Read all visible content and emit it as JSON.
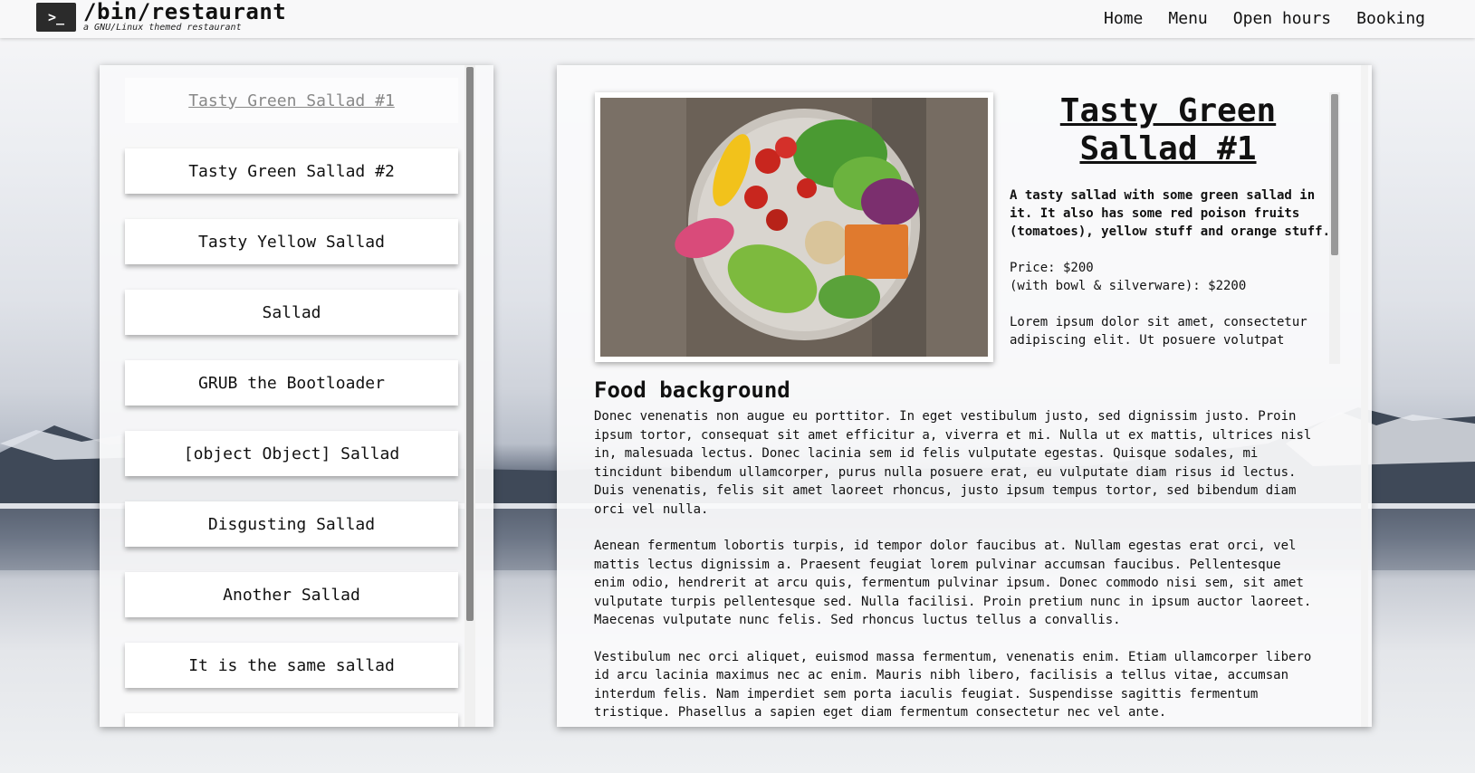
{
  "header": {
    "logo_glyph": ">_",
    "title": "/bin/restaurant",
    "tagline": "a GNU/Linux themed restaurant",
    "nav": [
      "Home",
      "Menu",
      "Open hours",
      "Booking"
    ]
  },
  "menu": {
    "items": [
      "Tasty Green Sallad #1",
      "Tasty Green Sallad #2",
      "Tasty Yellow Sallad",
      "Sallad",
      "GRUB the Bootloader",
      "[object Object] Sallad",
      "Disgusting Sallad",
      "Another Sallad",
      "It is the same sallad"
    ],
    "active_index": 0
  },
  "dish": {
    "title": "Tasty Green Sallad #1",
    "description": "A tasty sallad with some green sallad in it. It also has some red poison fruits (tomatoes), yellow stuff and orange stuff.",
    "price": "Price: $200",
    "price_bowl": "(with bowl & silverware): $2200",
    "lorem": "Lorem ipsum dolor sit amet, consectetur adipiscing elit. Ut posuere volutpat",
    "image_icon": "salad-bowl-photo"
  },
  "background": {
    "heading": "Food background",
    "paragraphs": [
      "Donec venenatis non augue eu porttitor. In eget vestibulum justo, sed dignissim justo. Proin ipsum tortor, consequat sit amet efficitur a, viverra et mi. Nulla ut ex mattis, ultrices nisl in, malesuada lectus. Donec lacinia sem id felis vulputate egestas. Quisque sodales, mi tincidunt bibendum ullamcorper, purus nulla posuere erat, eu vulputate diam risus id lectus. Duis venenatis, felis sit amet laoreet rhoncus, justo ipsum tempus tortor, sed bibendum diam orci vel nulla.",
      "Aenean fermentum lobortis turpis, id tempor dolor faucibus at. Nullam egestas erat orci, vel mattis lectus dignissim a. Praesent feugiat lorem pulvinar accumsan faucibus. Pellentesque enim odio, hendrerit at arcu quis, fermentum pulvinar ipsum. Donec commodo nisi sem, sit amet vulputate turpis pellentesque sed. Nulla facilisi. Proin pretium nunc in ipsum auctor laoreet. Maecenas vulputate nunc felis. Sed rhoncus luctus tellus a convallis.",
      "Vestibulum nec orci aliquet, euismod massa fermentum, venenatis enim. Etiam ullamcorper libero id arcu lacinia maximus nec ac enim. Mauris nibh libero, facilisis a tellus vitae, accumsan interdum felis. Nam imperdiet sem porta iaculis feugiat. Suspendisse sagittis fermentum tristique. Phasellus a sapien eget diam fermentum consectetur nec vel ante."
    ]
  },
  "colors": {
    "panel": "#f9f9fa",
    "text": "#111111",
    "logo_bg": "#2b2b2b",
    "active_item_text": "#888888"
  }
}
